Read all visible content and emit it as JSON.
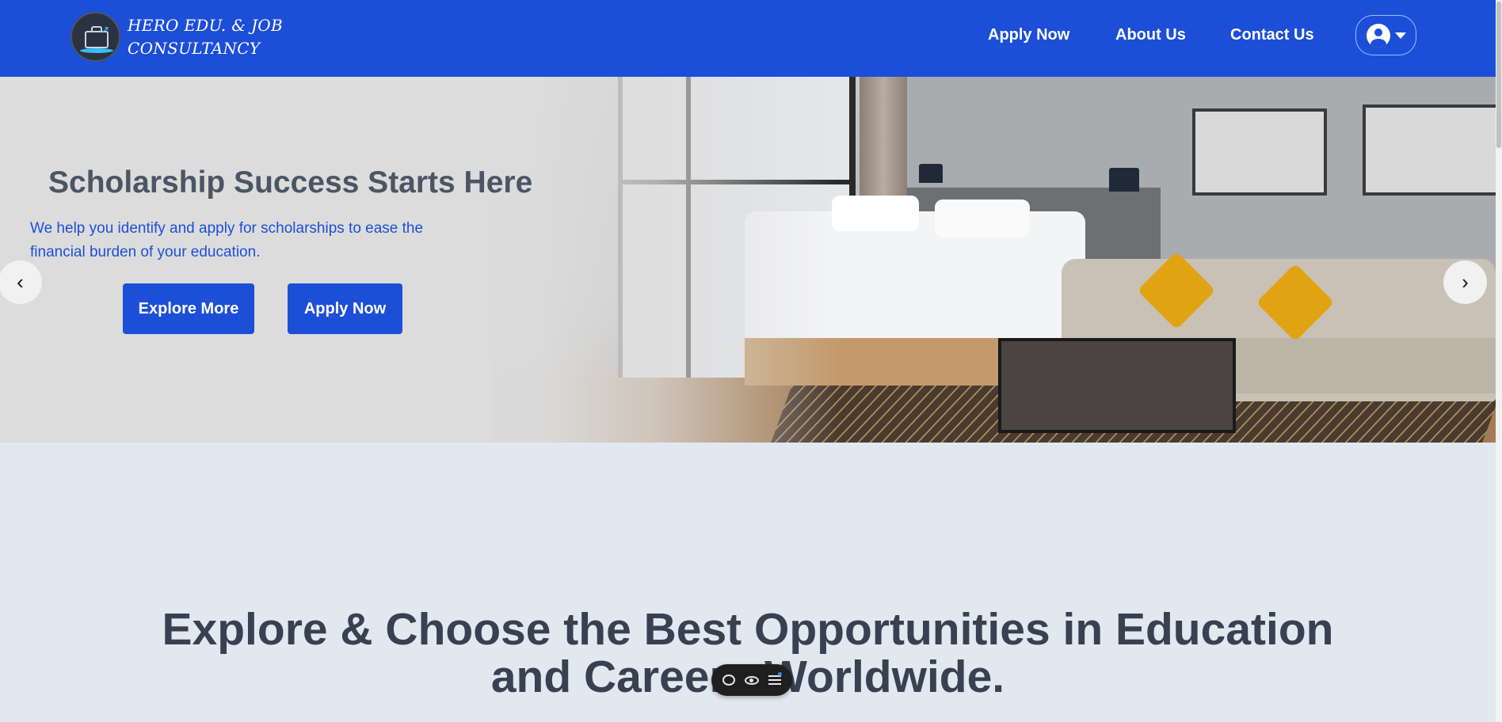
{
  "brand": {
    "line1": "HERO EDU. & JOB",
    "line2": "CONSULTANCY",
    "logo_icon": "briefcase-graduation-logo"
  },
  "nav": {
    "links": [
      {
        "label": "Apply Now"
      },
      {
        "label": "About Us"
      },
      {
        "label": "Contact Us"
      }
    ],
    "user_icon": "user-circle-icon",
    "dropdown_icon": "caret-down-icon"
  },
  "hero": {
    "title": "Scholarship Success Starts Here",
    "subtitle": "We help you identify and apply for scholarships to ease the financial burden of your education.",
    "buttons": {
      "explore": "Explore More",
      "apply": "Apply Now"
    },
    "prev_icon": "chevron-left-icon",
    "next_icon": "chevron-right-icon",
    "prev_glyph": "‹",
    "next_glyph": "›"
  },
  "main": {
    "headline_line1": "Explore & Choose the Best Opportunities in Education",
    "headline_line2": "and Careers Worldwide."
  },
  "toolbar": {
    "icons": [
      "chat-icon",
      "eye-icon",
      "list-icon"
    ]
  },
  "colors": {
    "primary": "#1d4ed8",
    "heading_gray": "#4b5563",
    "section_bg": "#e2e8f0"
  }
}
